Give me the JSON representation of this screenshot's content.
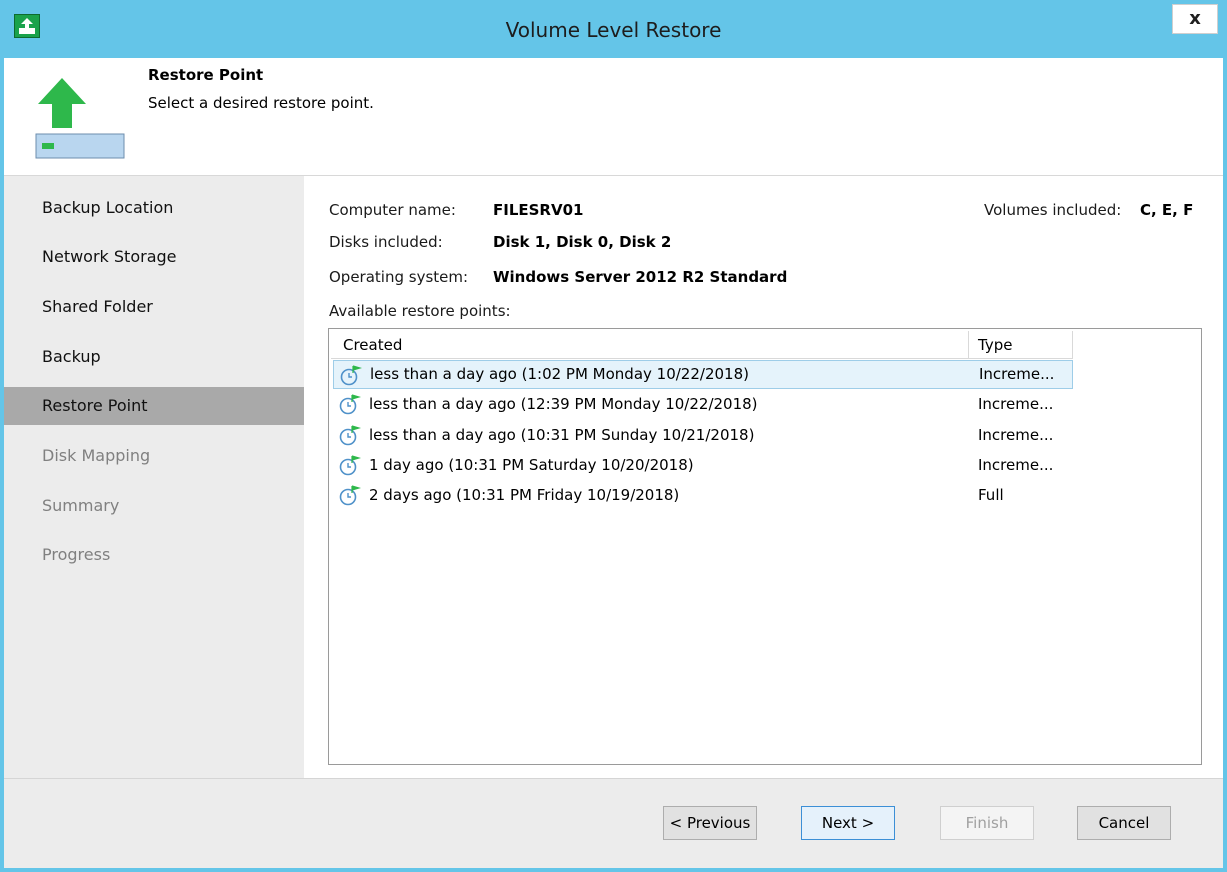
{
  "window": {
    "title": "Volume Level Restore",
    "close_label": "x"
  },
  "header": {
    "title": "Restore Point",
    "subtitle": "Select a desired restore point."
  },
  "sidebar": {
    "items": [
      {
        "label": "Backup Location",
        "state": "done"
      },
      {
        "label": "Network Storage",
        "state": "done"
      },
      {
        "label": "Shared Folder",
        "state": "done"
      },
      {
        "label": "Backup",
        "state": "done"
      },
      {
        "label": "Restore Point",
        "state": "active"
      },
      {
        "label": "Disk Mapping",
        "state": "disabled"
      },
      {
        "label": "Summary",
        "state": "disabled"
      },
      {
        "label": "Progress",
        "state": "disabled"
      }
    ]
  },
  "info": {
    "computer_name_label": "Computer name:",
    "computer_name": "FILESRV01",
    "volumes_label": "Volumes included:",
    "volumes": "C, E, F",
    "disks_label": "Disks included:",
    "disks": "Disk 1, Disk 0, Disk 2",
    "os_label": "Operating system:",
    "os": "Windows Server 2012 R2 Standard",
    "restore_points_label": "Available restore points:"
  },
  "grid": {
    "columns": [
      "Created",
      "Type"
    ],
    "rows": [
      {
        "created": "less than a day ago (1:02 PM Monday 10/22/2018)",
        "type": "Increme...",
        "selected": true
      },
      {
        "created": "less than a day ago (12:39 PM Monday 10/22/2018)",
        "type": "Increme...",
        "selected": false
      },
      {
        "created": "less than a day ago (10:31 PM Sunday 10/21/2018)",
        "type": "Increme...",
        "selected": false
      },
      {
        "created": "1 day ago (10:31 PM Saturday 10/20/2018)",
        "type": "Increme...",
        "selected": false
      },
      {
        "created": "2 days ago (10:31 PM Friday 10/19/2018)",
        "type": "Full",
        "selected": false
      }
    ]
  },
  "buttons": {
    "previous": "< Previous",
    "next": "Next >",
    "finish": "Finish",
    "cancel": "Cancel"
  },
  "colors": {
    "titlebar": "#64c5e8",
    "accent_green": "#2eb84b",
    "selection": "#e5f3fb",
    "sidebar_active": "#a9a9a9"
  },
  "icons": {
    "app": "restore-app-icon",
    "header": "volume-restore-icon",
    "row": "restore-point-clock-icon"
  }
}
